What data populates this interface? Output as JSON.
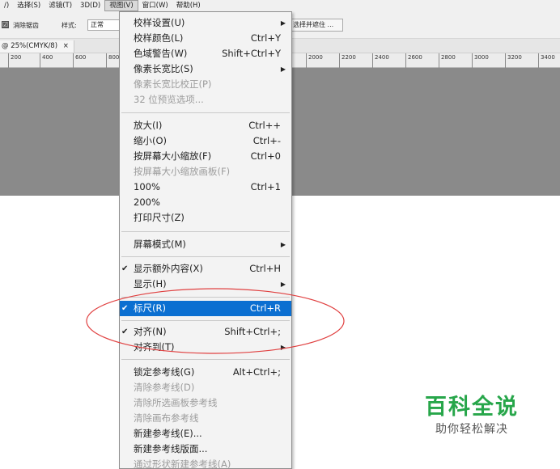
{
  "menubar": {
    "items": [
      {
        "label": "/)"
      },
      {
        "label": "选择(S)"
      },
      {
        "label": "滤镜(T)"
      },
      {
        "label": "3D(D)"
      },
      {
        "label": "视图(V)",
        "active": true
      },
      {
        "label": "窗口(W)"
      },
      {
        "label": "帮助(H)"
      }
    ]
  },
  "options": {
    "antialias_label": "消除锯齿",
    "style_label": "样式:",
    "style_value": "正常",
    "mask_button": "选择并遮住 ..."
  },
  "doctab": {
    "title": "@ 25%(CMYK/8)",
    "close": "×"
  },
  "ruler": {
    "labels": [
      "200",
      "400",
      "600",
      "800",
      "2000",
      "2200",
      "2400",
      "2600",
      "2800",
      "3000",
      "3200",
      "3400"
    ]
  },
  "menu": {
    "items": [
      {
        "label": "校样设置(U)",
        "shortcut": "",
        "submenu": true
      },
      {
        "label": "校样颜色(L)",
        "shortcut": "Ctrl+Y"
      },
      {
        "label": "色域警告(W)",
        "shortcut": "Shift+Ctrl+Y"
      },
      {
        "label": "像素长宽比(S)",
        "shortcut": "",
        "submenu": true
      },
      {
        "label": "像素长宽比校正(P)",
        "shortcut": "",
        "disabled": true
      },
      {
        "label": "32 位预览选项...",
        "shortcut": "",
        "disabled": true
      },
      {
        "label": "放大(I)",
        "shortcut": "Ctrl++"
      },
      {
        "label": "缩小(O)",
        "shortcut": "Ctrl+-"
      },
      {
        "label": "按屏幕大小缩放(F)",
        "shortcut": "Ctrl+0"
      },
      {
        "label": "按屏幕大小缩放画板(F)",
        "shortcut": "",
        "disabled": true
      },
      {
        "label": "100%",
        "shortcut": "Ctrl+1"
      },
      {
        "label": "200%",
        "shortcut": ""
      },
      {
        "label": "打印尺寸(Z)",
        "shortcut": ""
      },
      {
        "label": "屏幕模式(M)",
        "shortcut": "",
        "submenu": true
      },
      {
        "label": "显示额外内容(X)",
        "shortcut": "Ctrl+H",
        "checked": true
      },
      {
        "label": "显示(H)",
        "shortcut": "",
        "submenu": true
      },
      {
        "label": "标尺(R)",
        "shortcut": "Ctrl+R",
        "checked": true,
        "highlight": true
      },
      {
        "label": "对齐(N)",
        "shortcut": "Shift+Ctrl+;",
        "checked": true
      },
      {
        "label": "对齐到(T)",
        "shortcut": "",
        "submenu": true
      },
      {
        "label": "锁定参考线(G)",
        "shortcut": "Alt+Ctrl+;"
      },
      {
        "label": "清除参考线(D)",
        "shortcut": "",
        "disabled": true
      },
      {
        "label": "清除所选画板参考线",
        "shortcut": "",
        "disabled": true
      },
      {
        "label": "清除画布参考线",
        "shortcut": "",
        "disabled": true
      },
      {
        "label": "新建参考线(E)...",
        "shortcut": ""
      },
      {
        "label": "新建参考线版面...",
        "shortcut": ""
      },
      {
        "label": "通过形状新建参考线(A)",
        "shortcut": "",
        "disabled": true
      }
    ]
  },
  "watermark": {
    "title": "百科全说",
    "subtitle": "助你轻松解决"
  },
  "colors": {
    "highlight": "#0b6fd1",
    "annotation": "#e04040",
    "watermark_green": "#27a64a"
  },
  "icons": {
    "check": "✔",
    "submenu": "▶",
    "checkbox": "☑"
  }
}
